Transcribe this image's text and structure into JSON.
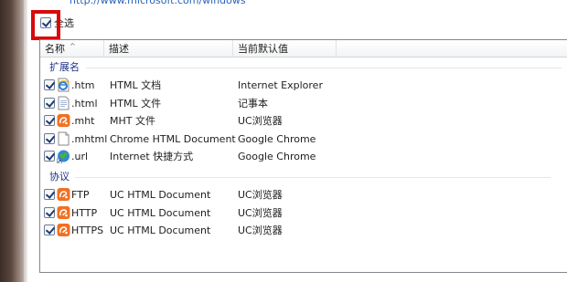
{
  "top_link": "http://www.microsoft.com/windows",
  "select_all": {
    "label": "全选",
    "checked": true
  },
  "columns": {
    "name": "名称",
    "description": "描述",
    "current_default": "当前默认值"
  },
  "groups": [
    {
      "title": "扩展名",
      "rows": [
        {
          "name": ".htm",
          "description": "HTML 文档",
          "current_default": "Internet Explorer",
          "icon": "ie-document-icon",
          "checked": true
        },
        {
          "name": ".html",
          "description": "HTML 文件",
          "current_default": "记事本",
          "icon": "notepad-document-icon",
          "checked": true
        },
        {
          "name": ".mht",
          "description": "MHT 文件",
          "current_default": "UC浏览器",
          "icon": "uc-browser-icon",
          "checked": true
        },
        {
          "name": ".mhtml",
          "description": "Chrome HTML Document",
          "current_default": "Google Chrome",
          "icon": "blank-document-icon",
          "checked": true
        },
        {
          "name": ".url",
          "description": "Internet 快捷方式",
          "current_default": "Google Chrome",
          "icon": "globe-shortcut-icon",
          "checked": true
        }
      ]
    },
    {
      "title": "协议",
      "rows": [
        {
          "name": "FTP",
          "description": "UC HTML Document",
          "current_default": "UC浏览器",
          "icon": "uc-browser-icon",
          "checked": true
        },
        {
          "name": "HTTP",
          "description": "UC HTML Document",
          "current_default": "UC浏览器",
          "icon": "uc-browser-icon",
          "checked": true
        },
        {
          "name": "HTTPS",
          "description": "UC HTML Document",
          "current_default": "UC浏览器",
          "icon": "uc-browser-icon",
          "checked": true
        }
      ]
    }
  ],
  "colors": {
    "highlight": "#d80a0a",
    "group_header": "#1e3287",
    "link": "#2a63b6"
  }
}
